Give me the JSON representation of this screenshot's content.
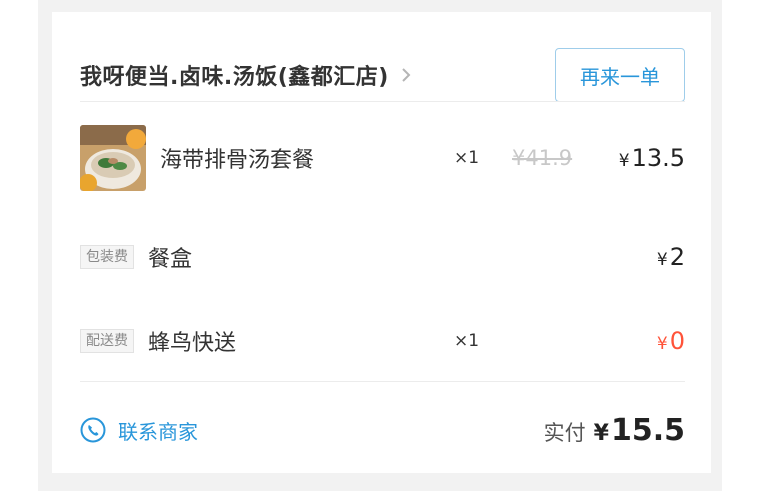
{
  "shop": {
    "name": "我呀便当.卤味.汤饭(鑫都汇店)",
    "reorder_label": "再来一单"
  },
  "items": [
    {
      "name": "海带排骨汤套餐",
      "qty": "×1",
      "original_price": "¥41.9",
      "currency": "¥",
      "price": "13.5"
    }
  ],
  "fees": [
    {
      "tag": "包装费",
      "name": "餐盒",
      "qty": "",
      "currency": "¥",
      "price": "2"
    },
    {
      "tag": "配送费",
      "name": "蜂鸟快送",
      "qty": "×1",
      "currency": "¥",
      "price": "0"
    }
  ],
  "footer": {
    "contact_label": "联系商家",
    "paid_label": "实付",
    "currency": "¥",
    "paid_value": "15.5"
  },
  "colors": {
    "accent": "#2996da",
    "accent_border": "#9fcdea",
    "zero_price": "#ff5339"
  }
}
